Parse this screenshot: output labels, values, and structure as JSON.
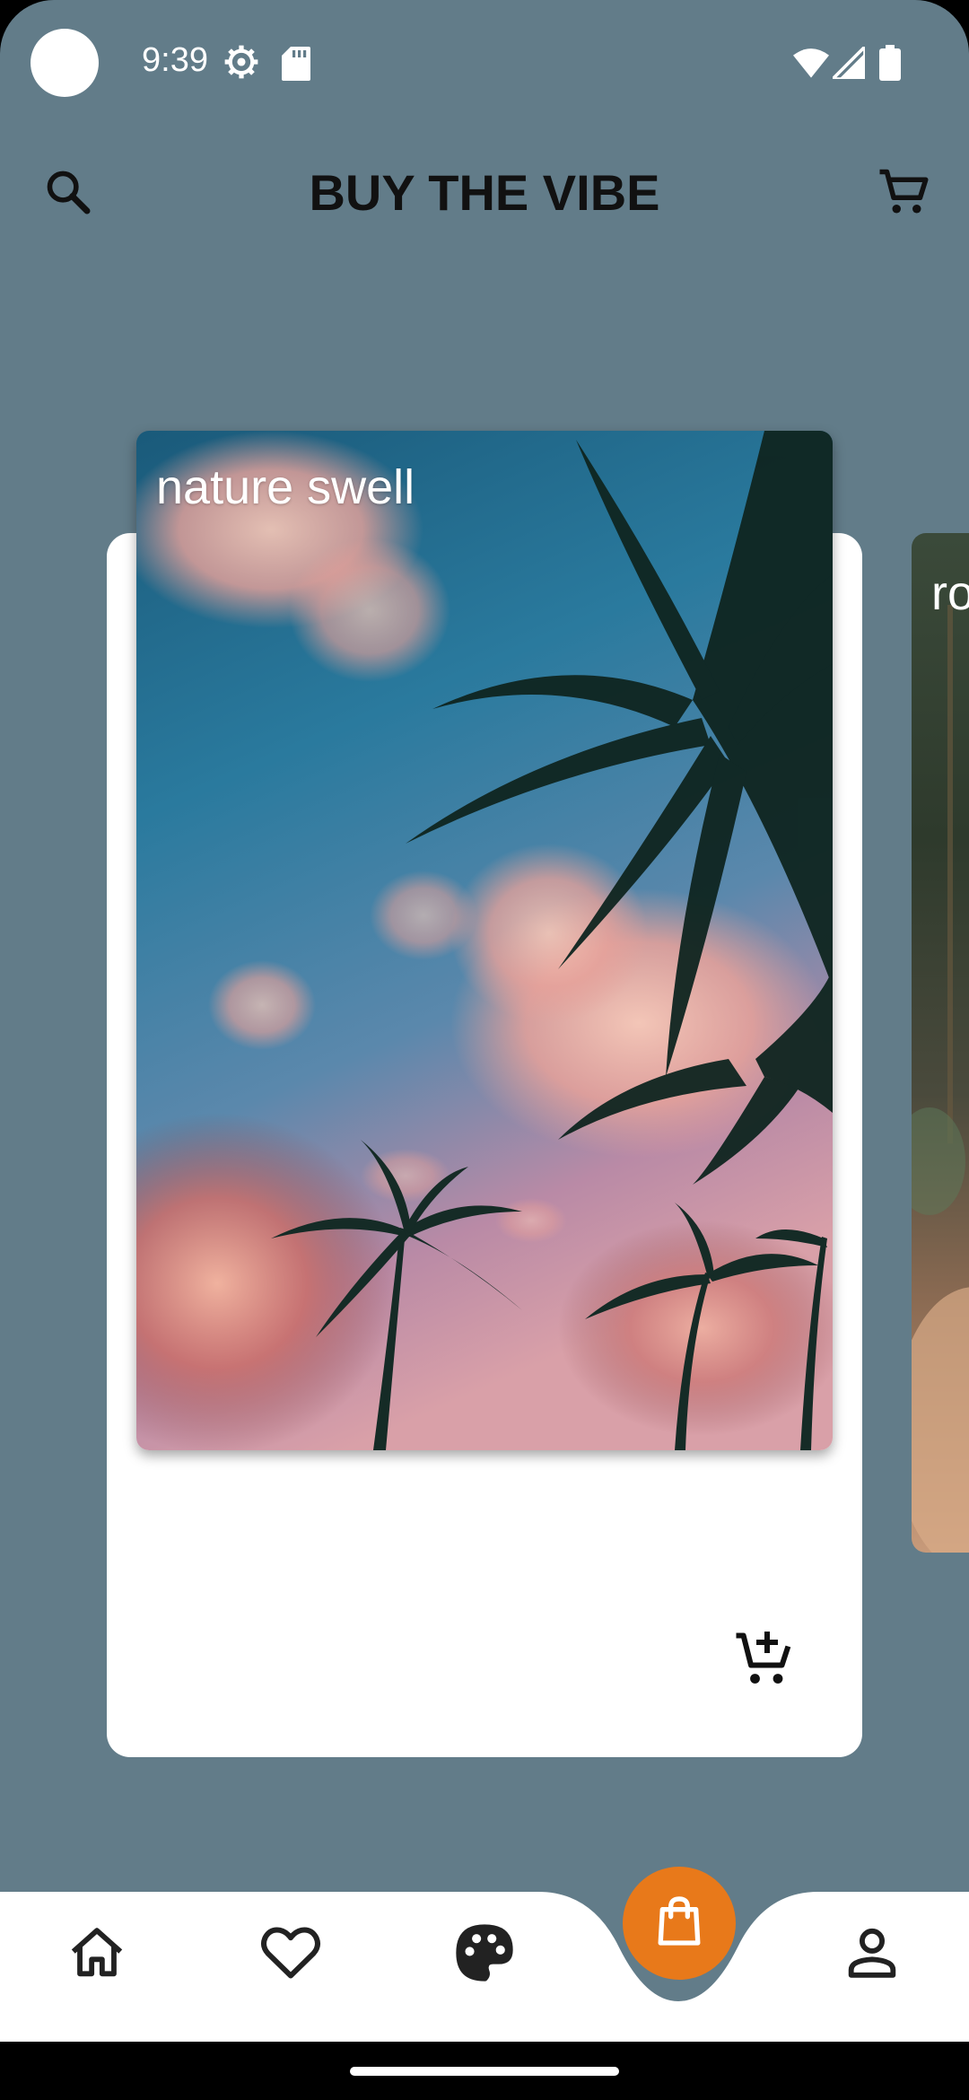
{
  "status_bar": {
    "time": "9:39",
    "icons": [
      "settings-gear-icon",
      "sd-card-icon",
      "wifi-icon",
      "cell-signal-icon",
      "battery-icon"
    ]
  },
  "top_bar": {
    "title": "BUY THE VIBE",
    "left_icon": "search-icon",
    "right_icon": "cart-icon"
  },
  "carousel": {
    "current_card": {
      "title": "nature swell",
      "action_icon": "add-to-cart-icon"
    },
    "next_card": {
      "title": "ro"
    }
  },
  "bottom_nav": {
    "items": [
      {
        "icon": "home-icon"
      },
      {
        "icon": "heart-icon"
      },
      {
        "icon": "palette-icon"
      },
      {
        "icon": "shopping-bag-icon"
      },
      {
        "icon": "person-icon"
      }
    ]
  },
  "colors": {
    "background": "#627c89",
    "card": "#ffffff",
    "accent": "#e8791a",
    "text_dark": "#111111"
  }
}
